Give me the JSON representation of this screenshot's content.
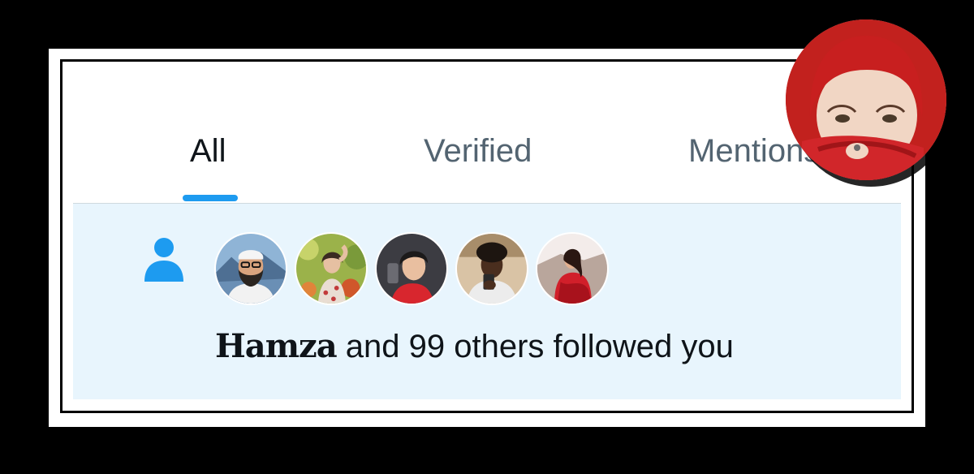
{
  "tabs": [
    {
      "label": "All",
      "active": true
    },
    {
      "label": "Verified",
      "active": false
    },
    {
      "label": "Mentions",
      "active": false
    }
  ],
  "notification": {
    "icon": "person-icon",
    "user_name": "Hamza",
    "action_text": " and 99 others followed you",
    "avatar_count": 5
  },
  "colors": {
    "accent": "#1d9bf0",
    "notif_background": "#e8f5fd",
    "text_primary": "#0f1419",
    "text_secondary": "#536471"
  }
}
